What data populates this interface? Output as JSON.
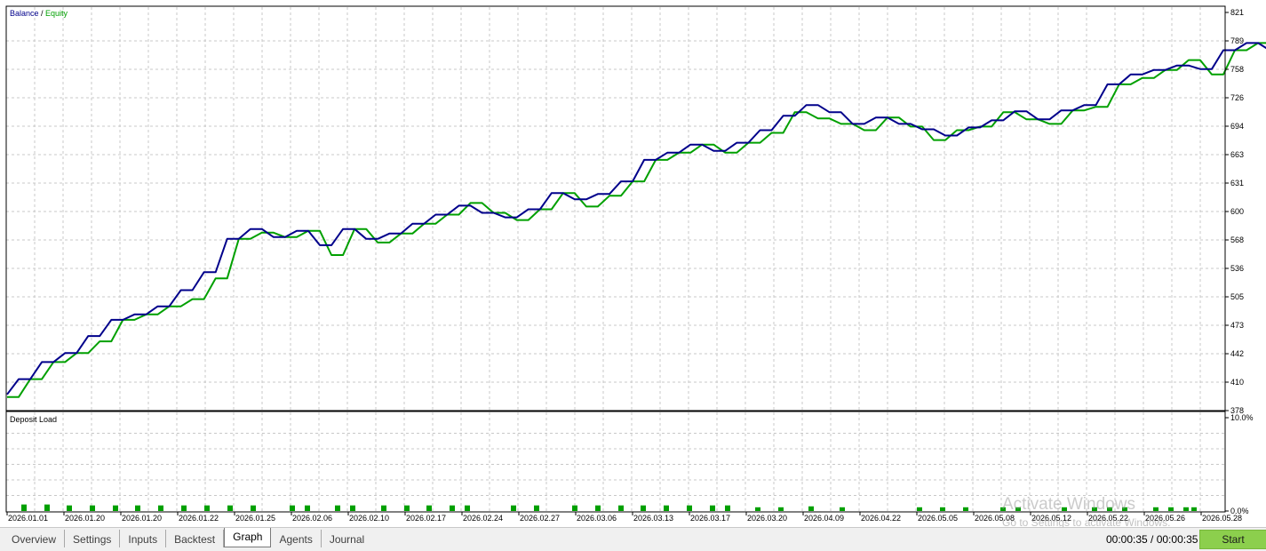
{
  "chart_data": [
    {
      "type": "line",
      "legend": [
        {
          "name": "Balance",
          "color": "#00008b"
        },
        {
          "name": "Equity",
          "color": "#00a000"
        }
      ],
      "legend_separator": " / ",
      "y_ticks": [
        "821",
        "789",
        "758",
        "726",
        "694",
        "663",
        "631",
        "600",
        "568",
        "536",
        "505",
        "473",
        "442",
        "410",
        "378"
      ],
      "ylim": [
        378,
        821
      ],
      "grid": true,
      "x_ticks": [
        "2026.01.01",
        "2026.01.20",
        "2026.01.20",
        "2026.01.22",
        "2026.01.25",
        "2026.02.06",
        "2026.02.10",
        "2026.02.17",
        "2026.02.24",
        "2026.02.27",
        "2026.03.06",
        "2026.03.13",
        "2026.03.17",
        "2026.03.20",
        "2026.04.09",
        "2026.04.22",
        "2026.05.05",
        "2026.05.08",
        "2026.05.12",
        "2026.05.22",
        "2026.05.26",
        "2026.05.28"
      ],
      "x_count": 106,
      "series": [
        {
          "name": "Balance",
          "values": [
            396,
            413,
            413,
            432,
            432,
            442,
            442,
            461,
            461,
            479,
            479,
            485,
            485,
            494,
            494,
            512,
            512,
            532,
            532,
            569,
            569,
            580,
            580,
            571,
            571,
            578,
            578,
            562,
            562,
            580,
            580,
            569,
            569,
            575,
            575,
            586,
            586,
            596,
            596,
            606,
            606,
            598,
            598,
            593,
            593,
            602,
            602,
            620,
            620,
            613,
            613,
            619,
            619,
            633,
            633,
            657,
            657,
            665,
            665,
            674,
            674,
            667,
            667,
            676,
            676,
            690,
            690,
            706,
            706,
            718,
            718,
            710,
            710,
            697,
            697,
            704,
            704,
            697,
            697,
            691,
            691,
            684,
            684,
            693,
            693,
            701,
            701,
            711,
            711,
            702,
            702,
            712,
            712,
            718,
            718,
            741,
            741,
            752,
            752,
            757,
            757,
            762,
            762,
            758,
            758,
            779,
            779,
            787,
            787,
            779,
            779
          ]
        },
        {
          "name": "Equity",
          "values": [
            393,
            393,
            413,
            413,
            432,
            432,
            442,
            442,
            455,
            455,
            479,
            479,
            485,
            485,
            494,
            494,
            502,
            502,
            525,
            525,
            569,
            569,
            576,
            576,
            571,
            571,
            578,
            578,
            551,
            551,
            580,
            580,
            565,
            565,
            575,
            575,
            586,
            586,
            596,
            596,
            609,
            609,
            598,
            598,
            590,
            590,
            602,
            602,
            620,
            620,
            605,
            605,
            617,
            617,
            633,
            633,
            657,
            657,
            665,
            665,
            674,
            674,
            665,
            665,
            676,
            676,
            687,
            687,
            710,
            710,
            703,
            703,
            697,
            697,
            690,
            690,
            704,
            704,
            694,
            694,
            679,
            679,
            690,
            690,
            694,
            694,
            710,
            710,
            702,
            702,
            697,
            697,
            712,
            712,
            716,
            716,
            741,
            741,
            748,
            748,
            757,
            757,
            768,
            768,
            752,
            752,
            779,
            779,
            787,
            787,
            779,
            779
          ]
        }
      ]
    },
    {
      "type": "bar",
      "title": "Deposit Load",
      "y_ticks": [
        "10.0%",
        "0.0%"
      ],
      "ylim": [
        0,
        10
      ],
      "color": "#00a000",
      "values": [
        0.7,
        0.7,
        0.6,
        0.6,
        0.6,
        0.6,
        0.6,
        0.6,
        0.6,
        0.6,
        0.6,
        0.6,
        0.6,
        0.6,
        0.6,
        0.6,
        0.6,
        0.6,
        0.6,
        0.6,
        0.6,
        0.6,
        0.6,
        0.6,
        0.6,
        0.6,
        0.6,
        0.6,
        0.6,
        0.6,
        0.4,
        0.4,
        0.5,
        0.4,
        0.4,
        0.4,
        0.4,
        0.4,
        0.4,
        0.4,
        0.4,
        0.4,
        0.4,
        0.4,
        0.4,
        0.4,
        0.4
      ]
    }
  ],
  "tabs": [
    {
      "label": "Overview",
      "active": false
    },
    {
      "label": "Settings",
      "active": false
    },
    {
      "label": "Inputs",
      "active": false
    },
    {
      "label": "Backtest",
      "active": false
    },
    {
      "label": "Graph",
      "active": true
    },
    {
      "label": "Agents",
      "active": false
    },
    {
      "label": "Journal",
      "active": false
    }
  ],
  "timer": "00:00:35 / 00:00:35",
  "start_label": "Start",
  "watermark": {
    "title": "Activate Windows",
    "subtitle": "Go to Settings to activate Windows."
  }
}
